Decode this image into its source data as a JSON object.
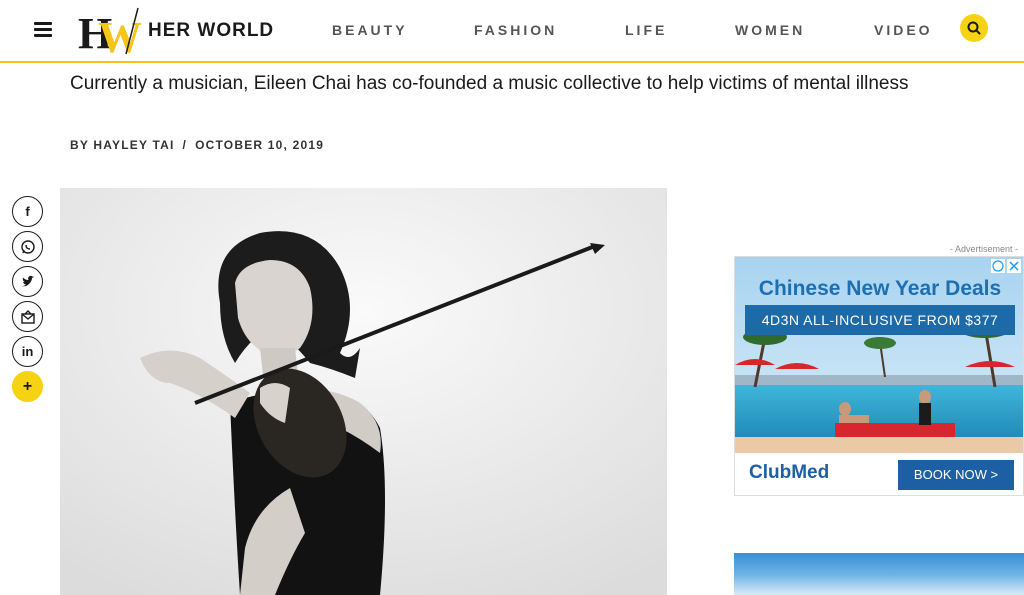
{
  "header": {
    "logo_mark": "HW",
    "brand": "HER WORLD",
    "nav": [
      "BEAUTY",
      "FASHION",
      "LIFE",
      "WOMEN",
      "VIDEO"
    ]
  },
  "article": {
    "subtitle": "Currently a musician, Eileen Chai has co-founded a music collective to help victims of mental illness",
    "author": "BY HAYLEY TAI",
    "separator": "/",
    "date": "OCTOBER 10, 2019"
  },
  "share": {
    "facebook": "f",
    "linkedin": "in",
    "more": "+"
  },
  "ad": {
    "label": "- Advertisement -",
    "title": "Chinese New Year Deals",
    "banner": "4D3N ALL-INCLUSIVE FROM $377",
    "brand": "ClubMed",
    "cta": "BOOK NOW >"
  },
  "colors": {
    "accent": "#f5d313",
    "ad_blue": "#1d5fa3"
  }
}
